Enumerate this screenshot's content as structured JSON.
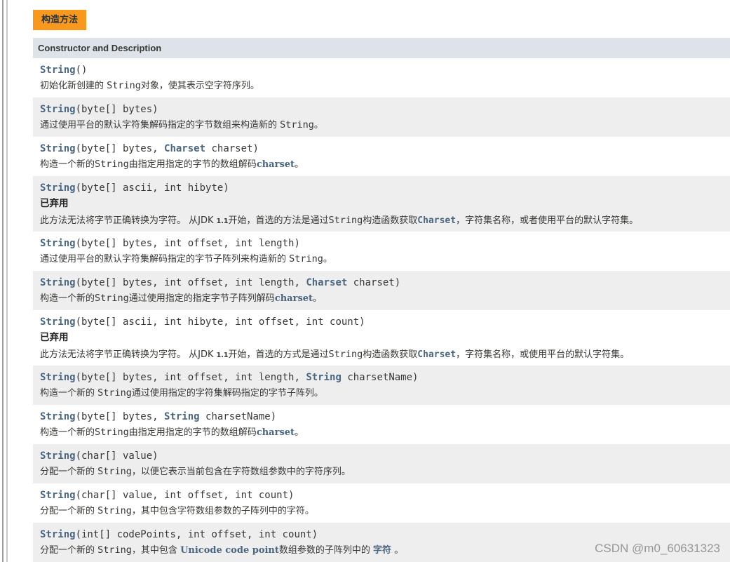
{
  "section": {
    "caption": "构造方法"
  },
  "table": {
    "header": "Constructor and Description"
  },
  "constructors": [
    {
      "sig": [
        {
          "t": "String",
          "k": "name"
        },
        {
          "t": "()",
          "k": "text"
        }
      ],
      "desc": [
        {
          "t": "初始化新创建的 ",
          "k": "text"
        },
        {
          "t": "String",
          "k": "mono"
        },
        {
          "t": "对象，使其表示空字符序列。",
          "k": "text"
        }
      ]
    },
    {
      "sig": [
        {
          "t": "String",
          "k": "name"
        },
        {
          "t": "(byte[] bytes)",
          "k": "text"
        }
      ],
      "desc": [
        {
          "t": "通过使用平台的默认字符集解码指定的字节数组来构造新的 ",
          "k": "text"
        },
        {
          "t": "String",
          "k": "mono"
        },
        {
          "t": "。",
          "k": "text"
        }
      ]
    },
    {
      "sig": [
        {
          "t": "String",
          "k": "name"
        },
        {
          "t": "(byte[] bytes, ",
          "k": "text"
        },
        {
          "t": "Charset",
          "k": "type"
        },
        {
          "t": " charset)",
          "k": "text"
        }
      ],
      "desc": [
        {
          "t": "构造一个新的",
          "k": "text"
        },
        {
          "t": "String",
          "k": "mono"
        },
        {
          "t": "由指定用指定的字节的数组解码",
          "k": "text"
        },
        {
          "t": "charset",
          "k": "link"
        },
        {
          "t": "。",
          "k": "text"
        }
      ]
    },
    {
      "sig": [
        {
          "t": "String",
          "k": "name"
        },
        {
          "t": "(byte[] ascii, int hibyte)",
          "k": "text"
        }
      ],
      "deprecated": "已弃用",
      "desc": [
        {
          "t": "此方法无法将字节正确转换为字符。 从JDK ",
          "k": "text"
        },
        {
          "t": "1.1",
          "k": "small"
        },
        {
          "t": "开始，首选的方法是通过",
          "k": "text"
        },
        {
          "t": "String",
          "k": "mono"
        },
        {
          "t": "构造函数获取",
          "k": "text"
        },
        {
          "t": "Charset",
          "k": "linkmono"
        },
        {
          "t": "，字符集名称，或者使用平台的默认字符集。",
          "k": "text"
        }
      ]
    },
    {
      "sig": [
        {
          "t": "String",
          "k": "name"
        },
        {
          "t": "(byte[] bytes, int offset, int length)",
          "k": "text"
        }
      ],
      "desc": [
        {
          "t": "通过使用平台的默认字符集解码指定的字节子阵列来构造新的 ",
          "k": "text"
        },
        {
          "t": "String",
          "k": "mono"
        },
        {
          "t": "。",
          "k": "text"
        }
      ]
    },
    {
      "sig": [
        {
          "t": "String",
          "k": "name"
        },
        {
          "t": "(byte[] bytes, int offset, int length, ",
          "k": "text"
        },
        {
          "t": "Charset",
          "k": "type"
        },
        {
          "t": " charset)",
          "k": "text"
        }
      ],
      "desc": [
        {
          "t": "构造一个新的",
          "k": "text"
        },
        {
          "t": "String",
          "k": "mono"
        },
        {
          "t": "通过使用指定的指定字节子阵列解码",
          "k": "text"
        },
        {
          "t": "charset",
          "k": "link"
        },
        {
          "t": "。",
          "k": "text"
        }
      ]
    },
    {
      "sig": [
        {
          "t": "String",
          "k": "name"
        },
        {
          "t": "(byte[] ascii, int hibyte, int offset, int count)",
          "k": "text"
        }
      ],
      "deprecated": "已弃用",
      "desc": [
        {
          "t": "此方法无法将字节正确转换为字符。 从JDK ",
          "k": "text"
        },
        {
          "t": "1.1",
          "k": "small"
        },
        {
          "t": "开始，首选的方式是通过",
          "k": "text"
        },
        {
          "t": "String",
          "k": "mono"
        },
        {
          "t": "构造函数获取",
          "k": "text"
        },
        {
          "t": "Charset",
          "k": "linkmono"
        },
        {
          "t": "，字符集名称，或使用平台的默认字符集。",
          "k": "text"
        }
      ]
    },
    {
      "sig": [
        {
          "t": "String",
          "k": "name"
        },
        {
          "t": "(byte[] bytes, int offset, int length, ",
          "k": "text"
        },
        {
          "t": "String",
          "k": "type"
        },
        {
          "t": " charsetName)",
          "k": "text"
        }
      ],
      "desc": [
        {
          "t": "构造一个新的 ",
          "k": "text"
        },
        {
          "t": "String",
          "k": "mono"
        },
        {
          "t": "通过使用指定的字符集解码指定的字节子阵列。",
          "k": "text"
        }
      ]
    },
    {
      "sig": [
        {
          "t": "String",
          "k": "name"
        },
        {
          "t": "(byte[] bytes, ",
          "k": "text"
        },
        {
          "t": "String",
          "k": "type"
        },
        {
          "t": " charsetName)",
          "k": "text"
        }
      ],
      "desc": [
        {
          "t": "构造一个新的",
          "k": "text"
        },
        {
          "t": "String",
          "k": "mono"
        },
        {
          "t": "由指定用指定的字节的数组解码",
          "k": "text"
        },
        {
          "t": "charset",
          "k": "link"
        },
        {
          "t": "。",
          "k": "text"
        }
      ]
    },
    {
      "sig": [
        {
          "t": "String",
          "k": "name"
        },
        {
          "t": "(char[] value)",
          "k": "text"
        }
      ],
      "desc": [
        {
          "t": "分配一个新的 ",
          "k": "text"
        },
        {
          "t": "String",
          "k": "mono"
        },
        {
          "t": "，以便它表示当前包含在字符数组参数中的字符序列。",
          "k": "text"
        }
      ]
    },
    {
      "sig": [
        {
          "t": "String",
          "k": "name"
        },
        {
          "t": "(char[] value, int offset, int count)",
          "k": "text"
        }
      ],
      "desc": [
        {
          "t": "分配一个新的 ",
          "k": "text"
        },
        {
          "t": "String",
          "k": "mono"
        },
        {
          "t": "，其中包含字符数组参数的子阵列中的字符。",
          "k": "text"
        }
      ]
    },
    {
      "sig": [
        {
          "t": "String",
          "k": "name"
        },
        {
          "t": "(int[] codePoints, int offset, int count)",
          "k": "text"
        }
      ],
      "desc": [
        {
          "t": "分配一个新的 ",
          "k": "text"
        },
        {
          "t": "String",
          "k": "mono"
        },
        {
          "t": "，其中包含 ",
          "k": "text"
        },
        {
          "t": "Unicode code point",
          "k": "link"
        },
        {
          "t": "数组参数的子阵列中的 ",
          "k": "text"
        },
        {
          "t": "字符",
          "k": "link"
        },
        {
          "t": " 。",
          "k": "text"
        }
      ]
    }
  ],
  "watermark": "CSDN @m0_60631323"
}
